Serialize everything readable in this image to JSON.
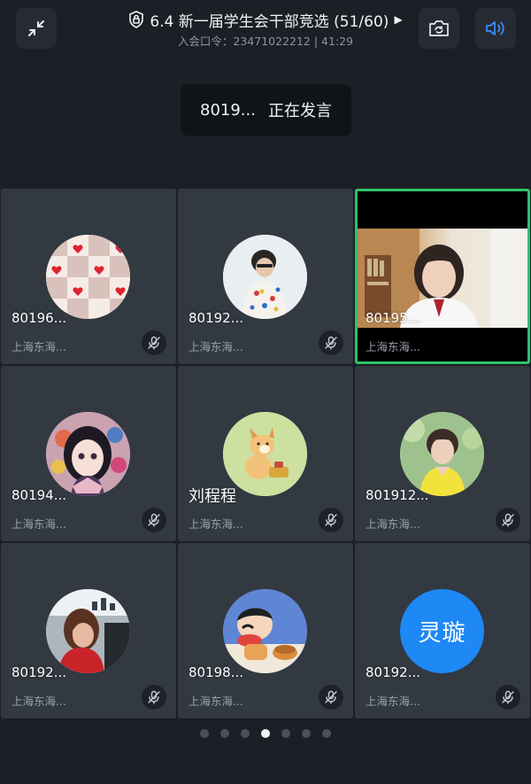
{
  "header": {
    "title": "6.4 新一届学生会干部竞选 (51/60)",
    "subtitle": "入会口令：23471022212 | 41:29"
  },
  "toast": {
    "name": "8019...",
    "status": "正在发言"
  },
  "participants": [
    {
      "name": "80196...",
      "location": "上海东海...",
      "avatar": "hearts-pattern",
      "muted": true
    },
    {
      "name": "80192...",
      "location": "上海东海...",
      "avatar": "boy-photo",
      "muted": true
    },
    {
      "name": "80195...",
      "location": "上海东海...",
      "avatar": "live-video",
      "muted": false,
      "active_speaker": true
    },
    {
      "name": "80194...",
      "location": "上海东海...",
      "avatar": "anime-girl",
      "muted": true
    },
    {
      "name": "刘程程",
      "location": "上海东海...",
      "avatar": "cartoon-dog",
      "muted": true
    },
    {
      "name": "801912...",
      "location": "上海东海...",
      "avatar": "boy-portrait",
      "muted": true
    },
    {
      "name": "80192...",
      "location": "上海东海...",
      "avatar": "girl-photo",
      "muted": true
    },
    {
      "name": "80198...",
      "location": "上海东海...",
      "avatar": "shinchan-cartoon",
      "muted": true
    },
    {
      "name": "80192...",
      "location": "上海东海...",
      "avatar_text": "灵璇",
      "muted": true
    }
  ],
  "pagination": {
    "pages": 7,
    "current": 4
  },
  "colors": {
    "background": "#1b1f26",
    "tile": "#323941",
    "active_border": "#2ec26a",
    "speaker_accent": "#3d8bff",
    "text_avatar": "#1e88f5"
  }
}
